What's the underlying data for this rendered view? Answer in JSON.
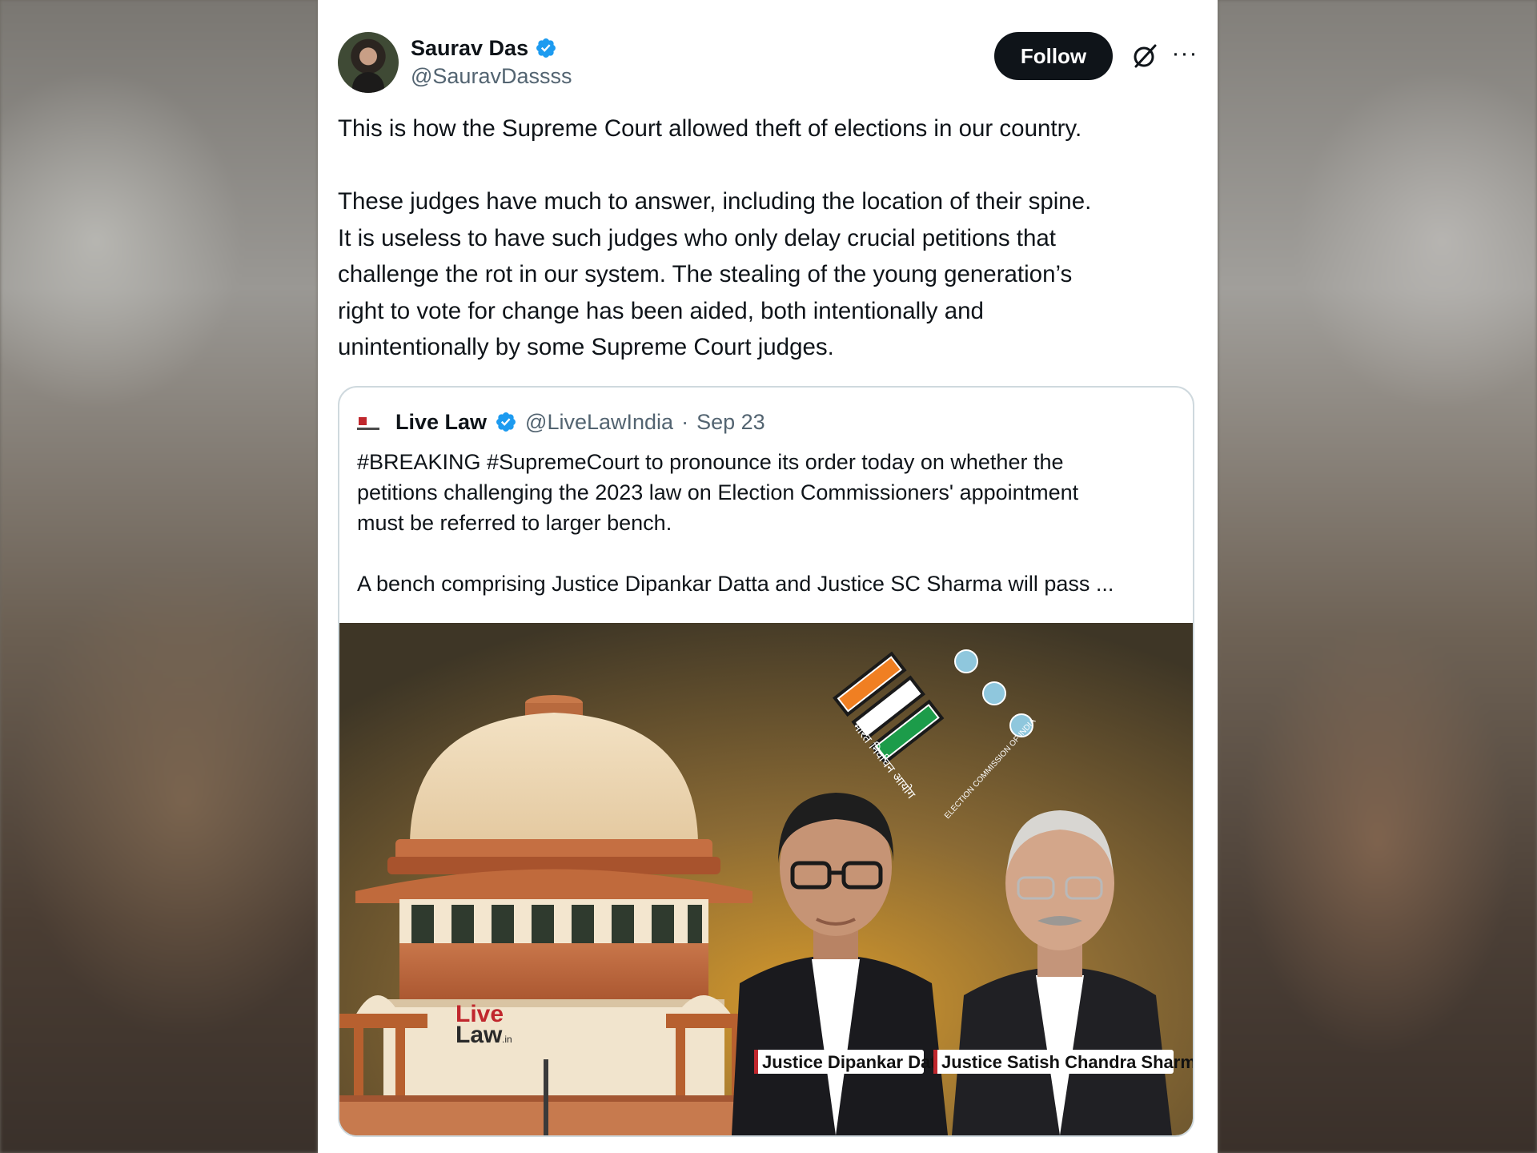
{
  "author": {
    "name": "Saurav Das",
    "handle": "@SauravDassss",
    "follow_label": "Follow"
  },
  "tweet": {
    "paragraph1": "This is how the Supreme Court allowed theft of elections in our country.",
    "paragraph2_lines": [
      "These judges have much to answer, including the location of their spine.",
      "It is useless to have such judges who only delay crucial petitions that",
      "challenge the rot in our system. The stealing of the young generation’s",
      "right to vote for change has been aided, both intentionally and",
      "unintentionally by some Supreme Court judges."
    ]
  },
  "quote": {
    "name": "Live Law",
    "handle": "@LiveLawIndia",
    "separator": "·",
    "date": "Sep 23",
    "body_lines": [
      "#BREAKING #SupremeCourt to pronounce its order today on whether the",
      "petitions challenging the 2023 law on Election Commissioners' appointment",
      "must be referred to larger bench."
    ],
    "body_line2": "A bench comprising Justice Dipankar Datta and Justice SC Sharma will pass ...",
    "image": {
      "watermark_line1": "Live",
      "watermark_line2": "Law",
      "watermark_suffix": ".in",
      "judge1_caption": "Justice Dipankar Datta",
      "judge2_caption": "Justice Satish Chandra Sharma",
      "eci_text_hindi": "भारत निर्वाचन आयोग",
      "eci_text_english": "ELECTION COMMISSION OF INDIA"
    }
  },
  "colors": {
    "verified_blue": "#1d9bf0",
    "follow_bg": "#0f1419",
    "saffron": "#f07f22",
    "green": "#1c9c4a",
    "livelaw_red": "#c0272d"
  },
  "icons": {
    "verified": "verified-badge-icon",
    "grok": "grok-icon",
    "more": "more-options-icon"
  }
}
